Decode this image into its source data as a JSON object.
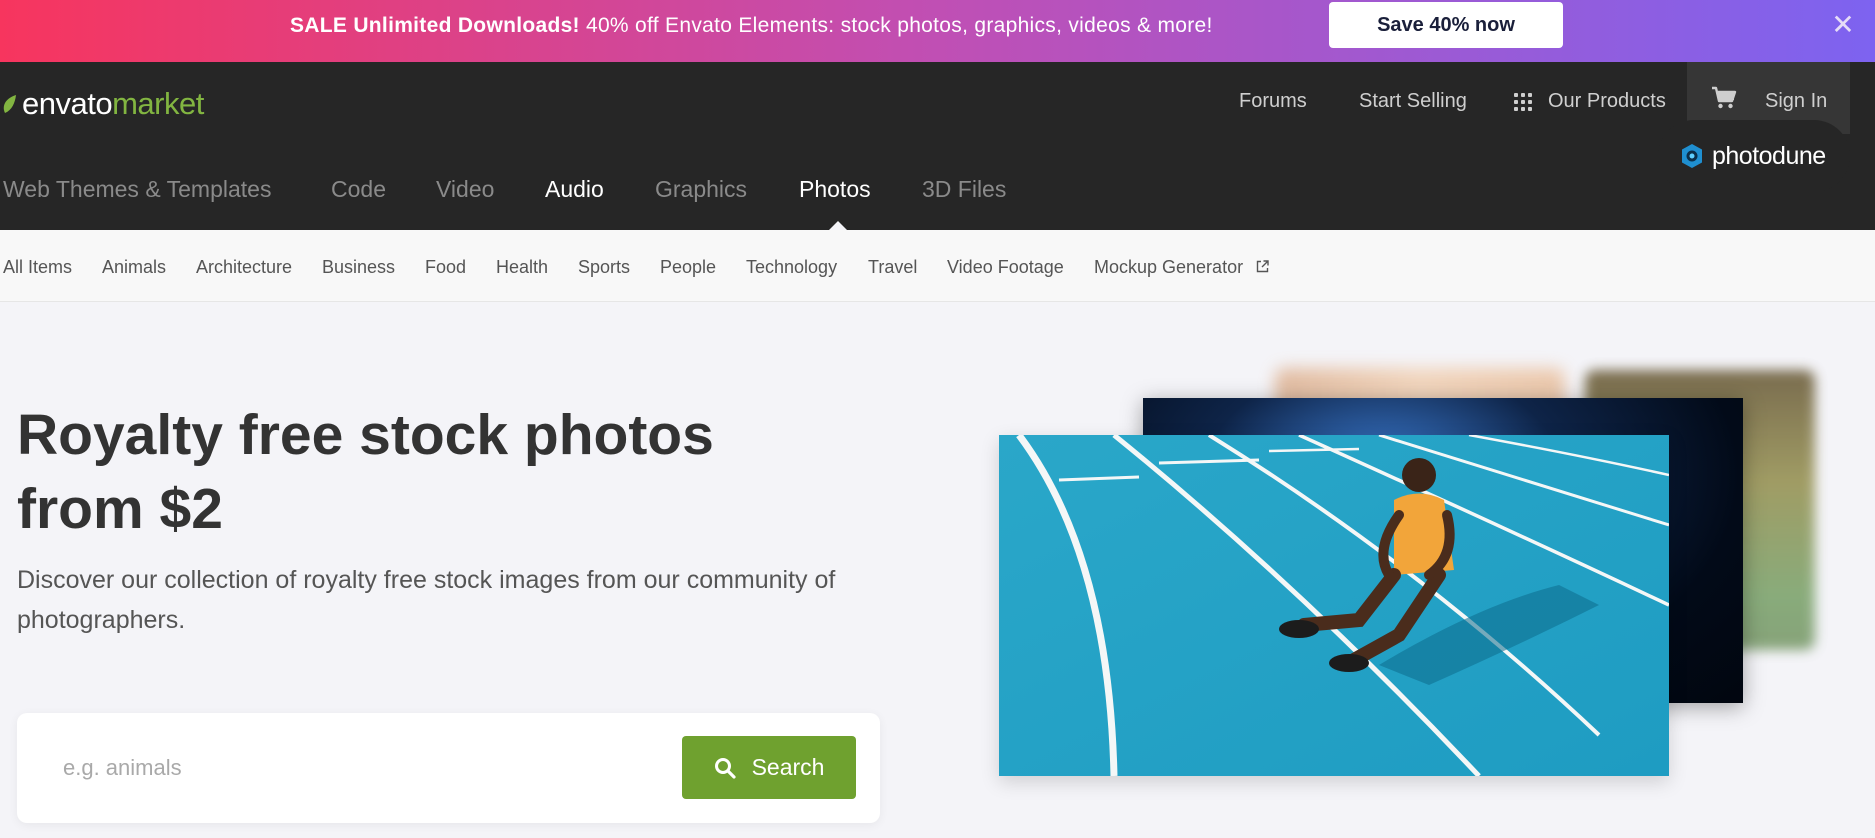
{
  "promo": {
    "bold": "SALE Unlimited Downloads!",
    "text": " 40% off Envato Elements: stock photos, graphics, videos & more!",
    "button": "Save 40% now",
    "close_icon": "close-icon"
  },
  "header": {
    "logo": {
      "envato": "envato",
      "market": "market"
    },
    "nav": {
      "forums": "Forums",
      "start_selling": "Start Selling",
      "our_products": "Our Products",
      "sign_in": "Sign In"
    },
    "categories": [
      {
        "label": "Web Themes & Templates",
        "active": false
      },
      {
        "label": "Code",
        "active": false
      },
      {
        "label": "Video",
        "active": false
      },
      {
        "label": "Audio",
        "active": false
      },
      {
        "label": "Graphics",
        "active": false
      },
      {
        "label": "Photos",
        "active": true
      },
      {
        "label": "3D Files",
        "active": false
      }
    ],
    "badge": "photodune"
  },
  "subnav": [
    "All Items",
    "Animals",
    "Architecture",
    "Business",
    "Food",
    "Health",
    "Sports",
    "People",
    "Technology",
    "Travel",
    "Video Footage",
    "Mockup Generator"
  ],
  "hero": {
    "title": "Royalty free stock photos from $2",
    "subtitle": "Discover our collection of royalty free stock images from our community of photographers.",
    "search": {
      "placeholder": "e.g. animals",
      "value": "",
      "button": "Search"
    }
  },
  "colors": {
    "brand_green": "#82b541",
    "search_green": "#6fa12f",
    "header_bg": "#262626",
    "promo_start": "#f7355e",
    "promo_end": "#7d63f0"
  }
}
